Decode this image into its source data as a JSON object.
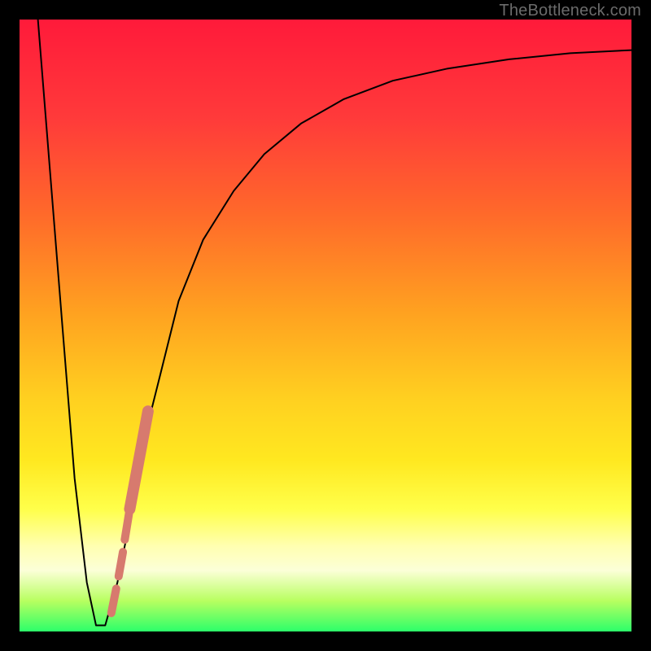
{
  "watermark": "TheBottleneck.com",
  "chart_data": {
    "type": "line",
    "title": "",
    "xlabel": "",
    "ylabel": "",
    "xlim": [
      0,
      100
    ],
    "ylim": [
      0,
      100
    ],
    "series": [
      {
        "name": "curve",
        "x": [
          3,
          5,
          7,
          9,
          11,
          12.5,
          14,
          16,
          18,
          20,
          23,
          26,
          30,
          35,
          40,
          46,
          53,
          61,
          70,
          80,
          90,
          100
        ],
        "y": [
          100,
          75,
          50,
          25,
          8,
          1,
          1,
          8,
          18,
          30,
          42,
          54,
          64,
          72,
          78,
          83,
          87,
          90,
          92,
          93.5,
          94.5,
          95
        ]
      }
    ],
    "highlight_segment": {
      "name": "salmon-dash-band",
      "color": "#d77a6e",
      "x": [
        15.0,
        15.8,
        16.2,
        16.9,
        17.2,
        18.0,
        18.0,
        21.0
      ],
      "y": [
        3.0,
        7.0,
        9.0,
        13.0,
        15.0,
        20.0,
        20.0,
        36.0
      ]
    },
    "background_gradient": {
      "top": "#ff1a3a",
      "mid": "#ffd020",
      "bottom": "#2cff6a"
    }
  }
}
